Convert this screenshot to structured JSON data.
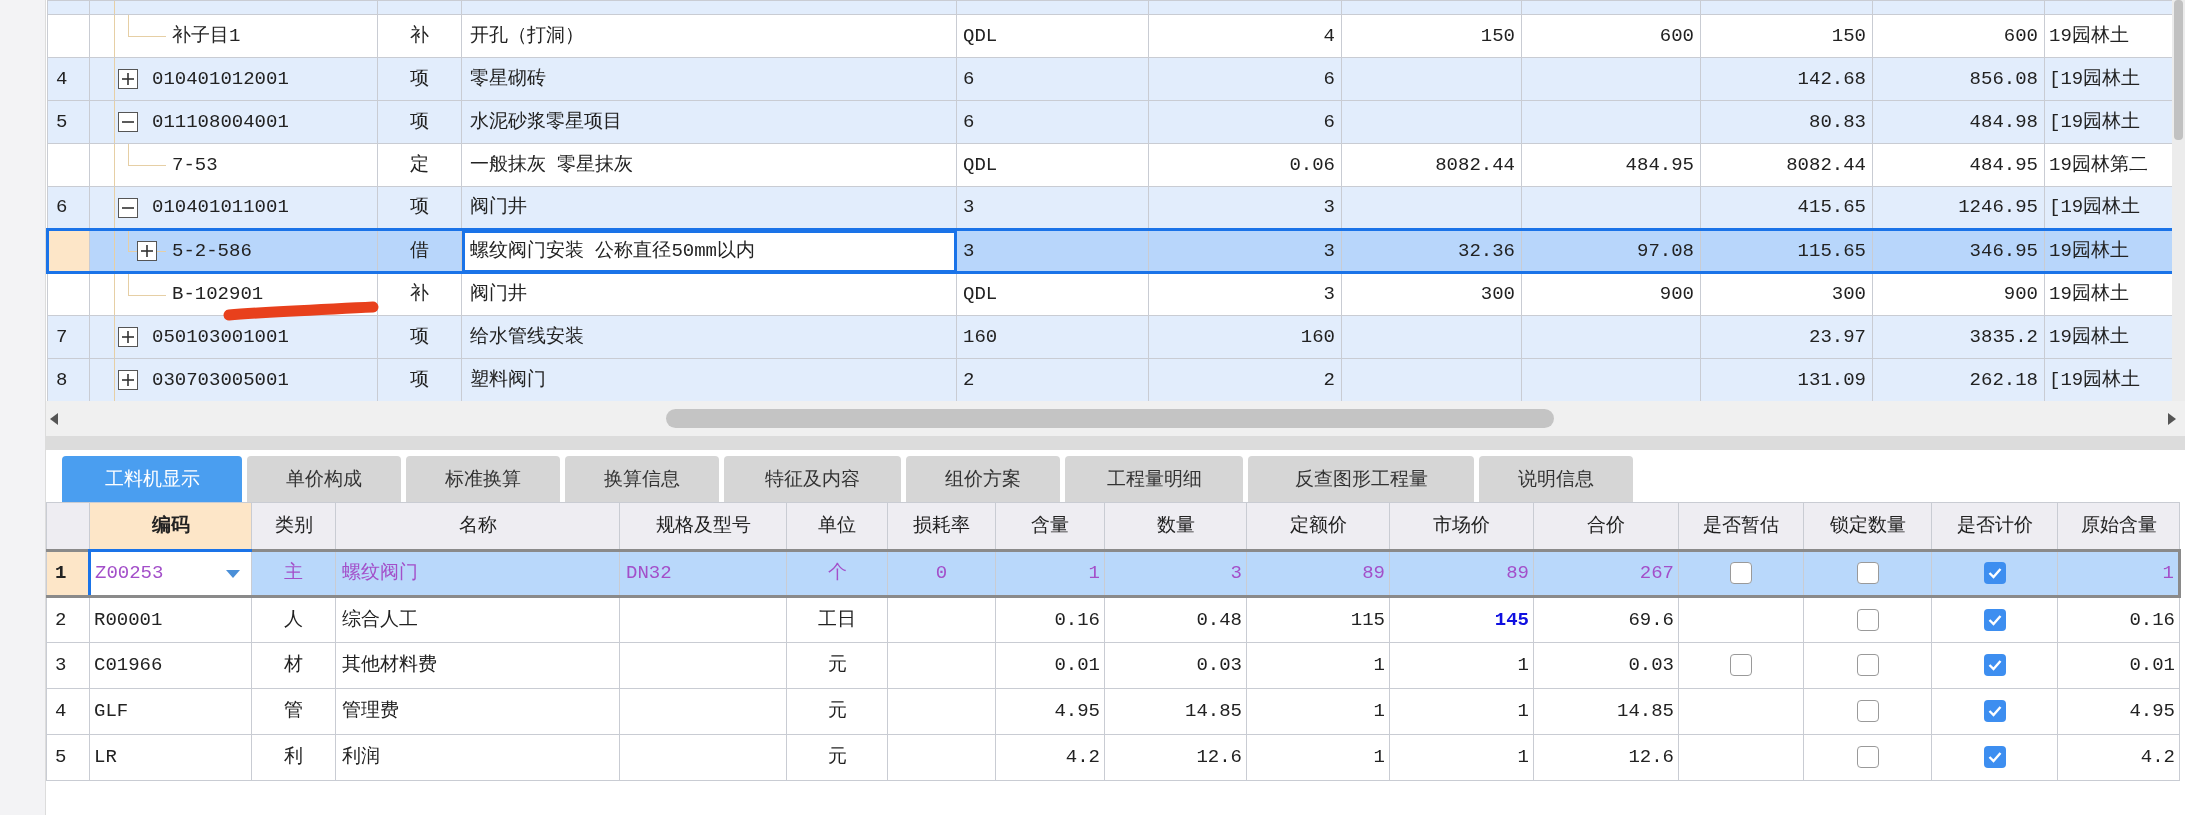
{
  "top_table": {
    "rows": [
      {
        "selected": false,
        "children": [
          {
            "code": "补子目1",
            "type": "补",
            "name": "开孔（打洞）",
            "cells": [
              "QDL",
              "4",
              "150",
              "600",
              "150",
              "600",
              "19园林土"
            ],
            "selected": false
          }
        ]
      },
      {
        "number": "4",
        "code": "010401012001",
        "expanded": false,
        "type": "项",
        "name": "零星砌砖",
        "cells": [
          "6",
          "6",
          null,
          null,
          "142.68",
          "856.08",
          "[19园林土"
        ],
        "selected": false
      },
      {
        "number": "5",
        "code": "011108004001",
        "expanded": true,
        "type": "项",
        "name": "水泥砂浆零星项目",
        "cells": [
          "6",
          "6",
          null,
          null,
          "80.83",
          "484.98",
          "[19园林土"
        ],
        "selected": false,
        "children": [
          {
            "code": "7-53",
            "type": "定",
            "name": "一般抹灰 零星抹灰",
            "cells": [
              "QDL",
              "0.06",
              "8082.44",
              "484.95",
              "8082.44",
              "484.95",
              "19园林第二"
            ],
            "selected": false
          }
        ]
      },
      {
        "number": "6",
        "code": "010401011001",
        "expanded": true,
        "type": "项",
        "name": "阀门井",
        "cells": [
          "3",
          "3",
          null,
          null,
          "415.65",
          "1246.95",
          "[19园林土"
        ],
        "selected": false,
        "children": [
          {
            "code": "5-2-586",
            "expanded": false,
            "type": "借",
            "name": "螺纹阀门安装 公称直径50mm以内",
            "cells": [
              "3",
              "3",
              "32.36",
              "97.08",
              "115.65",
              "346.95",
              "19园林土"
            ],
            "selected": true
          },
          {
            "code": "B-102901",
            "type": "补",
            "name": "阀门井",
            "cells": [
              "QDL",
              "3",
              "300",
              "900",
              "300",
              "900",
              "19园林土"
            ],
            "selected": false
          }
        ]
      },
      {
        "number": "7",
        "code": "050103001001",
        "expanded": false,
        "type": "项",
        "name": "给水管线安装",
        "cells": [
          "160",
          "160",
          null,
          null,
          "23.97",
          "3835.2",
          "19园林土"
        ],
        "selected": false
      },
      {
        "number": "8",
        "code": "030703005001",
        "expanded": false,
        "type": "项",
        "name": "塑料阀门",
        "cells": [
          "2",
          "2",
          null,
          null,
          "131.09",
          "262.18",
          "[19园林土"
        ],
        "selected": false
      }
    ]
  },
  "tabs": [
    {
      "label": "工料机显示",
      "selected": true
    },
    {
      "label": "单价构成",
      "selected": false
    },
    {
      "label": "标准换算",
      "selected": false
    },
    {
      "label": "换算信息",
      "selected": false
    },
    {
      "label": "特征及内容",
      "selected": false
    },
    {
      "label": "组价方案",
      "selected": false
    },
    {
      "label": "工程量明细",
      "selected": false
    },
    {
      "label": "反查图形工程量",
      "selected": false
    },
    {
      "label": "说明信息",
      "selected": false
    }
  ],
  "detail_table": {
    "columns": [
      {
        "label": "编码",
        "selected": true
      },
      {
        "label": "类别",
        "selected": false
      },
      {
        "label": "名称",
        "selected": false
      },
      {
        "label": "规格及型号",
        "selected": false
      },
      {
        "label": "单位",
        "selected": false
      },
      {
        "label": "损耗率",
        "selected": false
      },
      {
        "label": "含量",
        "selected": false
      },
      {
        "label": "数量",
        "selected": false
      },
      {
        "label": "定额价",
        "selected": false
      },
      {
        "label": "市场价",
        "selected": false
      },
      {
        "label": "合价",
        "selected": false
      },
      {
        "label": "是否暂估",
        "selected": false
      },
      {
        "label": "锁定数量",
        "selected": false
      },
      {
        "label": "是否计价",
        "selected": false
      },
      {
        "label": "原始含量",
        "selected": false
      }
    ],
    "rows": [
      {
        "number": "1",
        "code": "Z00253",
        "category": "主",
        "name": "螺纹阀门",
        "spec": "DN32",
        "unit": "个",
        "loss_rate": "0",
        "content": "1",
        "quantity": "3",
        "quota_price": "89",
        "market_price": "89",
        "total": "267",
        "provisional": false,
        "locked": false,
        "priced": true,
        "original_content": "1",
        "market_price_adjusted": false,
        "selected": true
      },
      {
        "number": "2",
        "code": "R00001",
        "category": "人",
        "name": "综合人工",
        "unit": "工日",
        "content": "0.16",
        "quantity": "0.48",
        "quota_price": "115",
        "market_price": "145",
        "total": "69.6",
        "locked": false,
        "priced": true,
        "original_content": "0.16",
        "market_price_adjusted": true,
        "selected": false
      },
      {
        "number": "3",
        "code": "C01966",
        "category": "材",
        "name": "其他材料费",
        "unit": "元",
        "content": "0.01",
        "quantity": "0.03",
        "quota_price": "1",
        "market_price": "1",
        "total": "0.03",
        "provisional": false,
        "locked": false,
        "priced": true,
        "original_content": "0.01",
        "market_price_adjusted": false,
        "selected": false
      },
      {
        "number": "4",
        "code": "GLF",
        "category": "管",
        "name": "管理费",
        "unit": "元",
        "content": "4.95",
        "quantity": "14.85",
        "quota_price": "1",
        "market_price": "1",
        "total": "14.85",
        "locked": false,
        "priced": true,
        "original_content": "4.95",
        "market_price_adjusted": false,
        "selected": false
      },
      {
        "number": "5",
        "code": "LR",
        "category": "利",
        "name": "利润",
        "unit": "元",
        "content": "4.2",
        "quantity": "12.6",
        "quota_price": "1",
        "market_price": "1",
        "total": "12.6",
        "locked": false,
        "priced": true,
        "original_content": "4.2",
        "market_price_adjusted": false,
        "selected": false
      }
    ]
  }
}
